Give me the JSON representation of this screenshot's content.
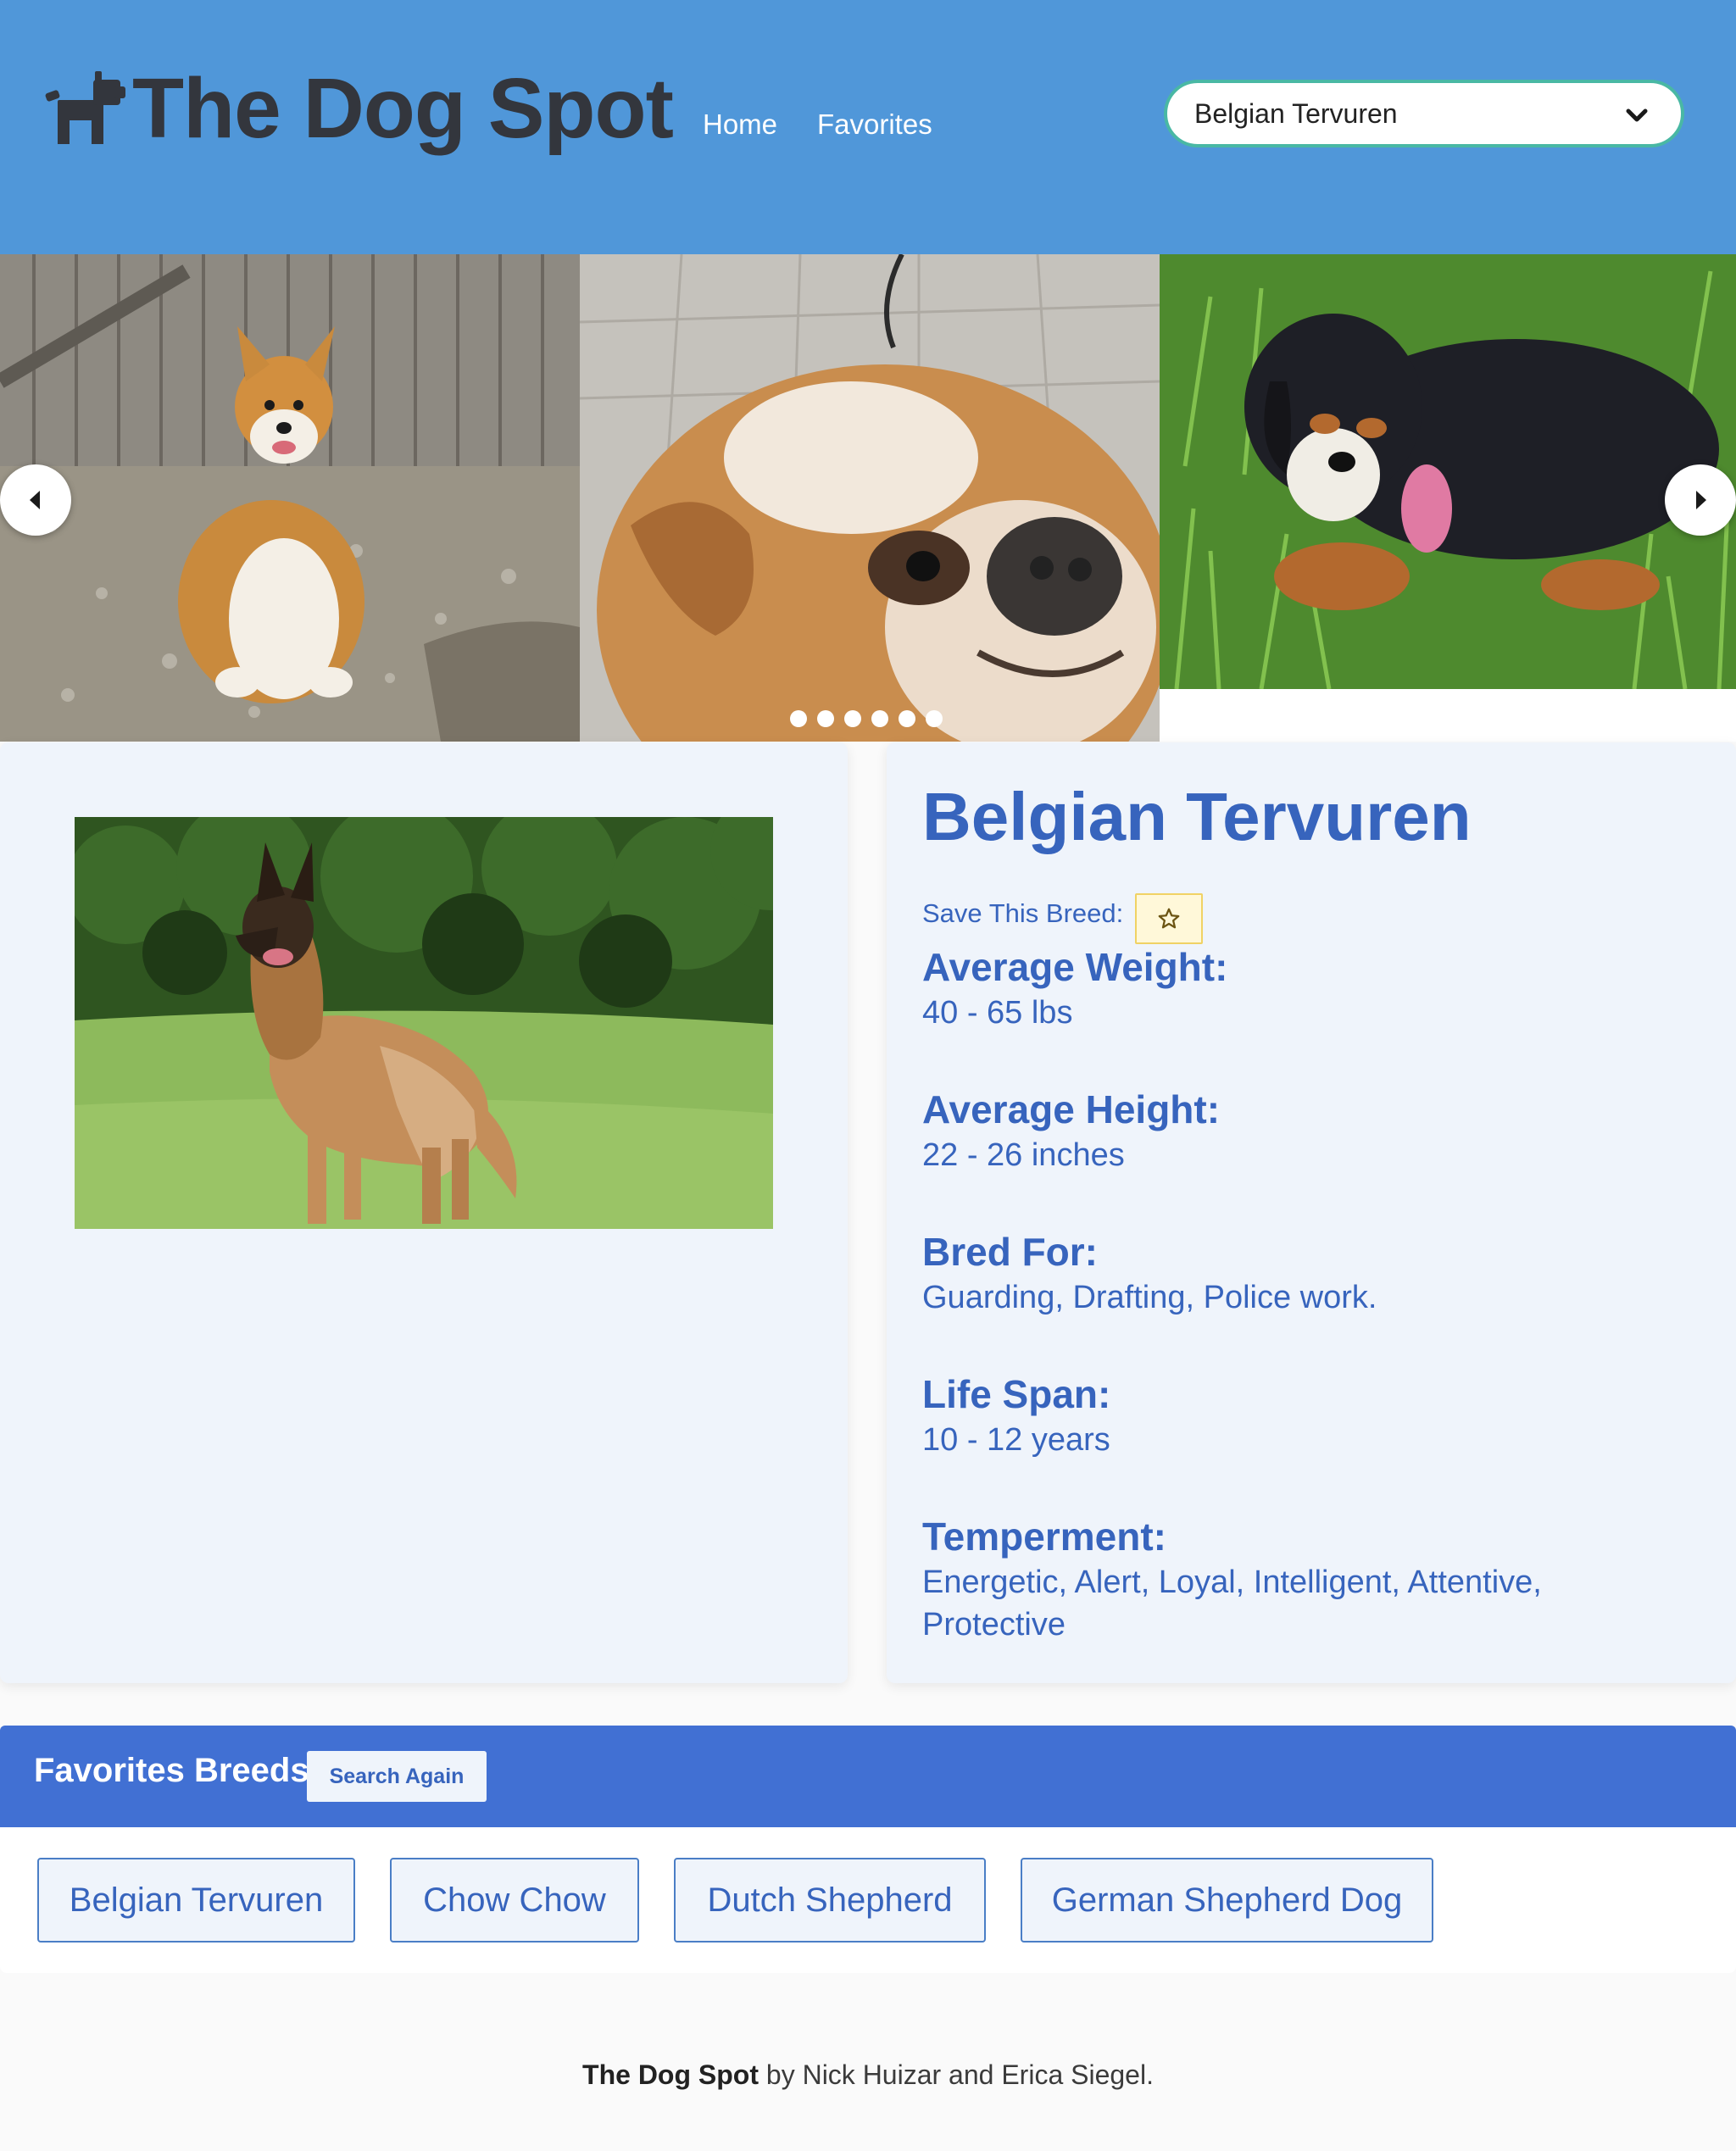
{
  "header": {
    "brand": "The Dog Spot",
    "nav": [
      "Home",
      "Favorites"
    ],
    "select_value": "Belgian Tervuren",
    "brand_icon": "dog-icon"
  },
  "carousel": {
    "slides": [
      "corgi-photo",
      "bulldog-photo",
      "mountain-dog-photo"
    ],
    "dot_count": 6
  },
  "breed": {
    "name": "Belgian Tervuren",
    "save_label": "Save This Breed:",
    "save_icon": "star-icon",
    "stats": [
      {
        "label": "Average Weight:",
        "value": "40 - 65 lbs"
      },
      {
        "label": "Average Height:",
        "value": "22 - 26 inches"
      },
      {
        "label": "Bred For:",
        "value": "Guarding, Drafting, Police work."
      },
      {
        "label": "Life Span:",
        "value": "10 - 12 years"
      },
      {
        "label": "Temperment:",
        "value": "Energetic, Alert, Loyal, Intelligent, Attentive, Protective"
      }
    ]
  },
  "favorites": {
    "title": "Favorites Breeds",
    "search_again": "Search Again",
    "items": [
      "Belgian Tervuren",
      "Chow Chow",
      "Dutch Shepherd",
      "German Shepherd Dog"
    ]
  },
  "footer": {
    "brand": "The Dog Spot",
    "text": " by Nick Huizar and Erica Siegel."
  },
  "colors": {
    "navbar": "#5097d9",
    "accent": "#3764bd",
    "fav_bar": "#4170d3",
    "card_bg": "#eff4fb"
  }
}
